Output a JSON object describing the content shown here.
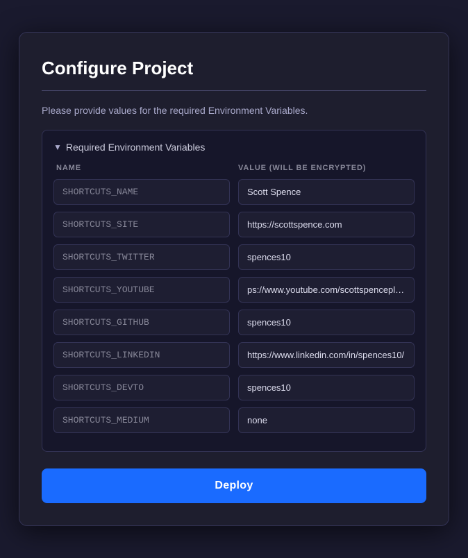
{
  "modal": {
    "title": "Configure Project",
    "description": "Please provide values for the required Environment Variables.",
    "section_header": "Required Environment Variables",
    "columns": {
      "name_label": "NAME",
      "value_label": "VALUE (WILL BE ENCRYPTED)"
    },
    "env_vars": [
      {
        "name": "SHORTCUTS_NAME",
        "value": "Scott Spence"
      },
      {
        "name": "SHORTCUTS_SITE",
        "value": "https://scottspence.com"
      },
      {
        "name": "SHORTCUTS_TWITTER",
        "value": "spences10"
      },
      {
        "name": "SHORTCUTS_YOUTUBE",
        "value": "ps://www.youtube.com/scottspenceplease"
      },
      {
        "name": "SHORTCUTS_GITHUB",
        "value": "spences10"
      },
      {
        "name": "SHORTCUTS_LINKEDIN",
        "value": "https://www.linkedin.com/in/spences10/"
      },
      {
        "name": "SHORTCUTS_DEVTO",
        "value": "spences10"
      },
      {
        "name": "SHORTCUTS_MEDIUM",
        "value": "none"
      }
    ],
    "deploy_button_label": "Deploy"
  }
}
